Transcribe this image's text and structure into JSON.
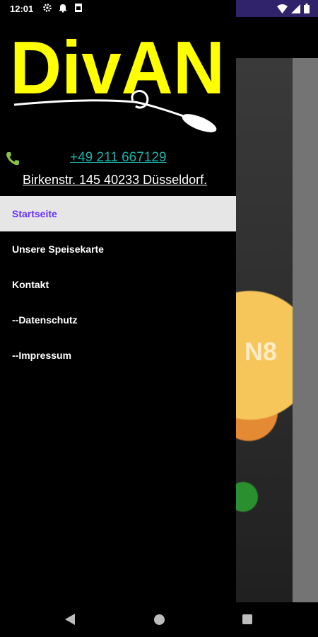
{
  "status_bar": {
    "time": "12:01",
    "left_icons": [
      "gear-icon",
      "bell-icon",
      "sim-icon"
    ],
    "right_icons": [
      "wifi-icon",
      "signal-icon",
      "battery-icon"
    ]
  },
  "brand": {
    "name": "DivAN",
    "text_color": "#ffff00"
  },
  "contact": {
    "phone": "+49 211 667129",
    "address": "Birkenstr. 145 40233 Düsseldorf."
  },
  "menu": {
    "items": [
      {
        "label": "Startseite",
        "active": true
      },
      {
        "label": "Unsere Speisekarte",
        "active": false
      },
      {
        "label": "Kontakt",
        "active": false
      },
      {
        "label": "--Datenschutz",
        "active": false
      },
      {
        "label": "--Impressum",
        "active": false
      }
    ]
  },
  "colors": {
    "active_text": "#6a30ff",
    "active_bg": "#e6e6e6",
    "phone_link": "#1bb3a6",
    "phone_icon": "#8bc34a"
  },
  "background_content": {
    "partial_text": "N8"
  },
  "nav_bar": {
    "buttons": [
      "back-icon",
      "home-icon",
      "recents-icon"
    ]
  }
}
